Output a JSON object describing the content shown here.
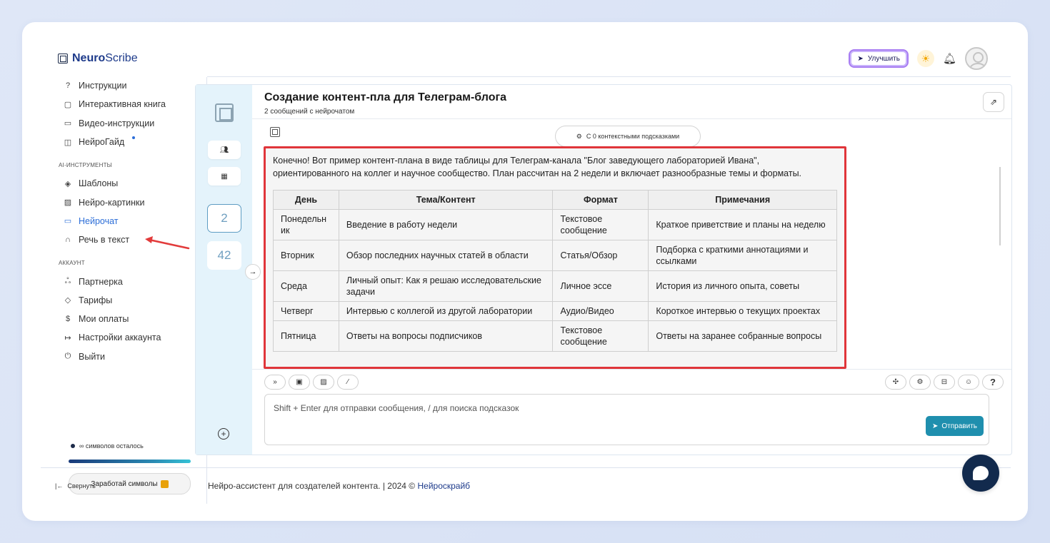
{
  "app": {
    "logo_bold": "Neuro",
    "logo_rest": "Scribe"
  },
  "topbar": {
    "upgrade_label": "Улучшить"
  },
  "sidebar": {
    "items_top": [
      {
        "label": "Инструкции",
        "icon": "help-circle-icon",
        "glyph": "?"
      },
      {
        "label": "Интерактивная книга",
        "icon": "book-icon",
        "glyph": "▢"
      },
      {
        "label": "Видео-инструкции",
        "icon": "video-icon",
        "glyph": "▭"
      },
      {
        "label": "НейроГайд",
        "icon": "guide-icon",
        "glyph": "◫"
      }
    ],
    "section_tools": "AI-ИНСТРУМЕНТЫ",
    "items_tools": [
      {
        "label": "Шаблоны",
        "icon": "layers-icon",
        "glyph": "◈"
      },
      {
        "label": "Нейро-картинки",
        "icon": "image-icon",
        "glyph": "▨"
      },
      {
        "label": "Нейрочат",
        "icon": "chat-icon",
        "glyph": "▭"
      },
      {
        "label": "Речь в текст",
        "icon": "headphones-icon",
        "glyph": "∩"
      }
    ],
    "section_account": "АККАУНТ",
    "items_account": [
      {
        "label": "Партнерка",
        "icon": "users-icon",
        "glyph": "ஃ"
      },
      {
        "label": "Тарифы",
        "icon": "tag-icon",
        "glyph": "◇"
      },
      {
        "label": "Мои оплаты",
        "icon": "dollar-icon",
        "glyph": "$"
      },
      {
        "label": "Настройки аккаунта",
        "icon": "login-icon",
        "glyph": "↦"
      },
      {
        "label": "Выйти",
        "icon": "power-icon",
        "glyph": "⏻"
      }
    ],
    "symbols_left": "∞ символов осталось",
    "earn_label": "Заработай символы",
    "collapse_label": "Свернуть"
  },
  "rail": {
    "count_messages": "2",
    "count_other": "42"
  },
  "chat": {
    "title": "Создание контент-пла для Телеграм-блога",
    "subtitle": "2 сообщений с нейрочатом",
    "context_hint": "С 0 контекстными подсказками",
    "intro": "Конечно! Вот пример контент-плана в виде таблицы для Телеграм-канала \"Блог заведующего лабораторией Ивана\", ориентированного на коллег и научное сообщество. План рассчитан на 2 недели и включает разнообразные темы и форматы.",
    "table": {
      "headers": [
        "День",
        "Тема/Контент",
        "Формат",
        "Примечания"
      ],
      "rows": [
        [
          "Понедельник",
          "Введение в работу недели",
          "Текстовое сообщение",
          "Краткое приветствие и планы на неделю"
        ],
        [
          "Вторник",
          "Обзор последних научных статей в области",
          "Статья/Обзор",
          "Подборка с краткими аннотациями и ссылками"
        ],
        [
          "Среда",
          "Личный опыт: Как я решаю исследовательские задачи",
          "Личное эссе",
          "История из личного опыта, советы"
        ],
        [
          "Четверг",
          "Интервью с коллегой из другой лаборатории",
          "Аудио/Видео",
          "Короткое интервью о текущих проектах"
        ],
        [
          "Пятница",
          "Ответы на вопросы подписчиков",
          "Текстовое сообщение",
          "Ответы на заранее собранные вопросы"
        ]
      ]
    },
    "input_placeholder": "Shift + Enter для отправки сообщения, / для поиска подсказок",
    "send_label": "Отправить",
    "help_label": "?"
  },
  "footer": {
    "text": "Нейро-ассистент для создателей контента.  | 2024 © ",
    "link": "Нейроскрайб"
  },
  "colors": {
    "accent": "#2c6ed8",
    "highlight_border": "#e0353a",
    "send": "#1f8fae",
    "rail": "#e4f3fb"
  }
}
